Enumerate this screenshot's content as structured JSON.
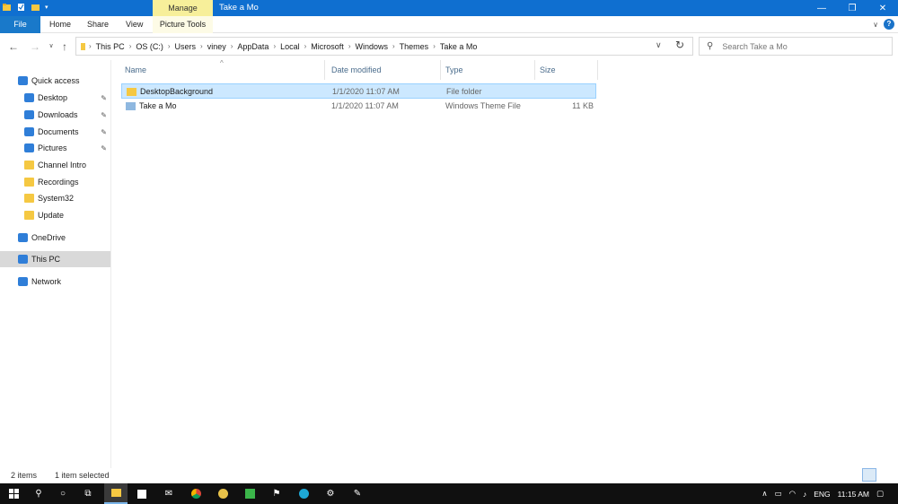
{
  "window": {
    "title": "Take a Mo",
    "contextual_tab": "Manage",
    "controls": {
      "minimize": "—",
      "restore": "❐",
      "close": "✕"
    }
  },
  "ribbon": {
    "file": "File",
    "tabs": [
      "Home",
      "Share",
      "View"
    ],
    "contextual": "Picture Tools"
  },
  "address": {
    "crumbs": [
      "This PC",
      "OS (C:)",
      "Users",
      "viney",
      "AppData",
      "Local",
      "Microsoft",
      "Windows",
      "Themes",
      "Take a Mo"
    ]
  },
  "search": {
    "placeholder": "Search Take a Mo"
  },
  "nav": {
    "items": [
      {
        "label": "Quick access",
        "icon": "star-icon",
        "pinned": false
      },
      {
        "label": "Desktop",
        "icon": "desktop-icon",
        "pinned": true
      },
      {
        "label": "Downloads",
        "icon": "download-icon",
        "pinned": true
      },
      {
        "label": "Documents",
        "icon": "documents-icon",
        "pinned": true
      },
      {
        "label": "Pictures",
        "icon": "pictures-icon",
        "pinned": true
      },
      {
        "label": "Channel Intro",
        "icon": "folder-icon",
        "pinned": false
      },
      {
        "label": "Recordings",
        "icon": "folder-icon",
        "pinned": false
      },
      {
        "label": "System32",
        "icon": "folder-icon",
        "pinned": false
      },
      {
        "label": "Update",
        "icon": "folder-icon",
        "pinned": false
      },
      {
        "label": "OneDrive",
        "icon": "cloud-icon",
        "pinned": false
      },
      {
        "label": "This PC",
        "icon": "computer-icon",
        "pinned": false
      },
      {
        "label": "Network",
        "icon": "network-icon",
        "pinned": false
      }
    ]
  },
  "columns": {
    "name": "Name",
    "date": "Date modified",
    "type": "Type",
    "size": "Size"
  },
  "files": [
    {
      "name": "DesktopBackground",
      "date": "1/1/2020 11:07 AM",
      "type": "File folder",
      "size": "",
      "icon": "folder-icon",
      "selected": true
    },
    {
      "name": "Take a Mo",
      "date": "1/1/2020 11:07 AM",
      "type": "Windows Theme File",
      "size": "11 KB",
      "icon": "theme-file-icon",
      "selected": false
    }
  ],
  "status": {
    "count": "2 items",
    "selection": "1 item selected"
  },
  "taskbar": {
    "lang": "ENG",
    "time": "11:15 AM"
  },
  "colors": {
    "titlebar": "#0f6fd0",
    "selection": "#cce8ff",
    "manage": "#f7ef9a"
  }
}
